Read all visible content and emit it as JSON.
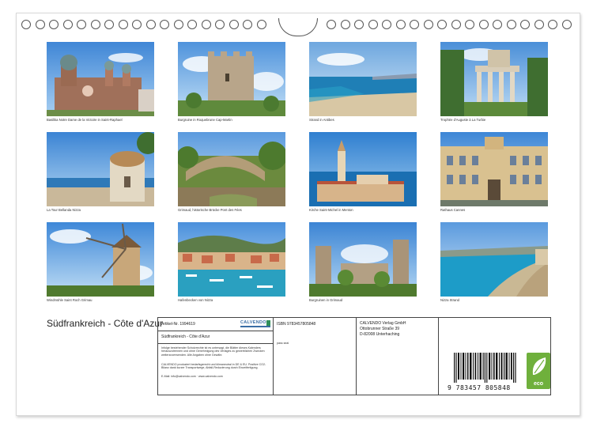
{
  "photos": [
    {
      "caption": "Basilika Notre Dame de la Victoire in Saint-Raphael",
      "icon": "basilica-image"
    },
    {
      "caption": "Burgruine in Roquebrune Cap-Martin",
      "icon": "castle-ruin-image"
    },
    {
      "caption": "Strand in Antibes",
      "icon": "beach-image"
    },
    {
      "caption": "Trophée d'Auguste à La Turbie",
      "icon": "roman-monument-image"
    },
    {
      "caption": "La Tour Bellanda Nizza",
      "icon": "tower-image"
    },
    {
      "caption": "Grimaud, historische Brücke Pont des Fées",
      "icon": "stone-bridge-image"
    },
    {
      "caption": "Kirche Saint-Michel in Menton",
      "icon": "church-image"
    },
    {
      "caption": "Rathaus Cannes",
      "icon": "town-hall-image"
    },
    {
      "caption": "Windmühle Saint Roch Grimau",
      "icon": "windmill-image"
    },
    {
      "caption": "Hafenbecken von Nizza",
      "icon": "harbour-image"
    },
    {
      "caption": "Burgruinen in Grimaud",
      "icon": "castle-ruins-image"
    },
    {
      "caption": "Nizza Strand",
      "icon": "nice-beach-image"
    }
  ],
  "title": "Südfrankreich - Côte d'Azur",
  "info": {
    "article_label": "Artikel-Nr. 1994619",
    "logo_text": "CALVENDO",
    "calendar_title": "Südfrankreich - Côte d'Azur",
    "isbn": "ISBN 9783457805848",
    "page_note": "pass seal",
    "publisher_name": "CALVENDO Verlag GmbH",
    "publisher_street": "Ottobrunner Straße 39",
    "publisher_city": "D-82008 Unterhaching",
    "legal_1": "Infolge bestehender Schutzrechte ist es untersagt, die Blätter dieses Kalenders herauszutrennen und ohne Genehmigung des Verlages zu gewerblichen Zwecken weiterzuverwenden. Alle Angaben ohne Gewähr.",
    "legal_2": "CALVENDO produziert bedarfsgerecht und klimaneutral in DE & EU. Positive CO2-Bilanz dank kurzer Transportwege, Abfall-Reduzierung durch Einzelfertigung.",
    "legal_3": "E-Mail: info@calvendo.com · www.calvendo.com",
    "barcode_number": "9 783457 805848",
    "eco_label": "eco"
  },
  "colors": {
    "border": "#444444",
    "eco_green": "#6fb03c",
    "brand_blue": "#3a6ea5"
  }
}
